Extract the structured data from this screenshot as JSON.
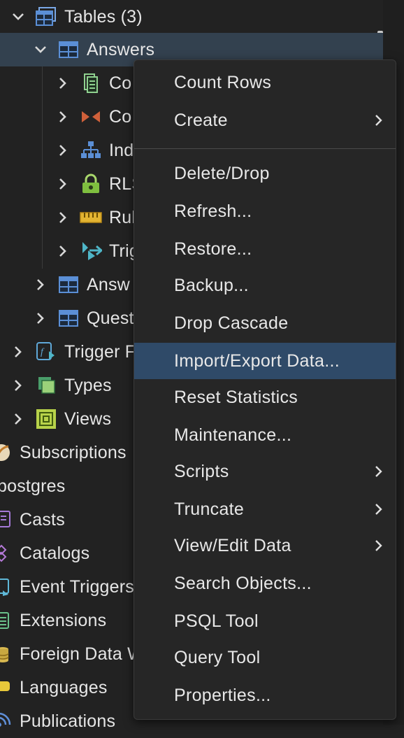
{
  "tree": {
    "tables": "Tables (3)",
    "answers": "Answers",
    "columns": "Co",
    "constraints": "Co",
    "indexes": "Ind",
    "rls": "RLS",
    "rules": "Rul",
    "triggers": "Trig",
    "answers2": "Answ",
    "questions": "Quest",
    "trigger_functions": "Trigger F",
    "types": "Types",
    "views": "Views",
    "subscriptions": "Subscriptions",
    "postgres": "postgres",
    "casts": "Casts",
    "catalogs": "Catalogs",
    "event_triggers": "Event Triggers",
    "extensions": "Extensions",
    "foreign_data": "Foreign Data W",
    "languages": "Languages",
    "publications": "Publications"
  },
  "menu": {
    "items": [
      {
        "label": "Count Rows"
      },
      {
        "label": "Create"
      },
      {
        "label": "Delete/Drop"
      },
      {
        "label": "Refresh..."
      },
      {
        "label": "Restore..."
      },
      {
        "label": "Backup..."
      },
      {
        "label": "Drop Cascade"
      },
      {
        "label": "Import/Export Data..."
      },
      {
        "label": "Reset Statistics"
      },
      {
        "label": "Maintenance..."
      },
      {
        "label": "Scripts"
      },
      {
        "label": "Truncate"
      },
      {
        "label": "View/Edit Data"
      },
      {
        "label": "Search Objects..."
      },
      {
        "label": "PSQL Tool"
      },
      {
        "label": "Query Tool"
      },
      {
        "label": "Properties..."
      }
    ]
  },
  "colors": {
    "background": "#222222",
    "selected_row": "#33414f",
    "menu_highlight": "#2f4a68",
    "table_icon": "#5b8fd6",
    "folder_icon": "#9bd17a"
  }
}
